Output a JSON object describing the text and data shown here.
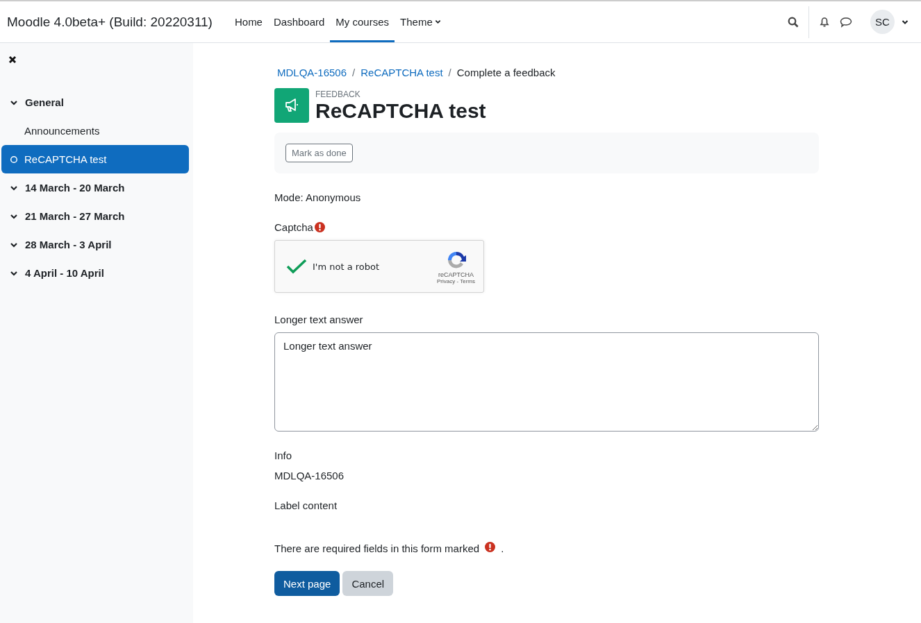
{
  "navbar": {
    "site_name": "Moodle 4.0beta+ (Build: 20220311)",
    "nav_items": [
      {
        "label": "Home",
        "selected": false,
        "kind": "link"
      },
      {
        "label": "Dashboard",
        "selected": false,
        "kind": "link"
      },
      {
        "label": "My courses",
        "selected": true,
        "kind": "link"
      },
      {
        "label": "Theme",
        "selected": false,
        "kind": "dropdown"
      }
    ],
    "avatar_initials": "SC"
  },
  "sidebar": {
    "items": [
      {
        "label": "General",
        "expanded": true,
        "children": [
          {
            "label": "Announcements",
            "selected": false
          },
          {
            "label": "ReCAPTCHA test",
            "selected": true
          }
        ]
      },
      {
        "label": "14 March - 20 March",
        "expanded": true
      },
      {
        "label": "21 March - 27 March",
        "expanded": true
      },
      {
        "label": "28 March - 3 April",
        "expanded": true
      },
      {
        "label": "4 April - 10 April",
        "expanded": true
      }
    ]
  },
  "breadcrumb_separator": "/",
  "breadcrumb": [
    {
      "label": "MDLQA-16506",
      "kind": "link"
    },
    {
      "label": "ReCAPTCHA test",
      "kind": "link"
    },
    {
      "label": "Complete a feedback",
      "kind": "current"
    }
  ],
  "activity": {
    "type_label": "FEEDBACK",
    "title": "ReCAPTCHA test",
    "completion_button": "Mark as done"
  },
  "mode": "Mode: Anonymous",
  "captcha": {
    "label": "Captcha",
    "required": true,
    "checked": true,
    "checkbox_label": "I'm not a robot",
    "brand": "reCAPTCHA",
    "links": "Privacy - Terms"
  },
  "longer_text": {
    "label": "Longer text answer",
    "value": "Longer text answer"
  },
  "info": {
    "label": "Info",
    "value": "MDLQA-16506"
  },
  "label_content": "Label content",
  "required_notice": {
    "text": "There are required fields in this form marked",
    "suffix": "."
  },
  "buttons": [
    {
      "label": "Next page",
      "kind": "primary"
    },
    {
      "label": "Cancel",
      "kind": "secondary"
    }
  ]
}
